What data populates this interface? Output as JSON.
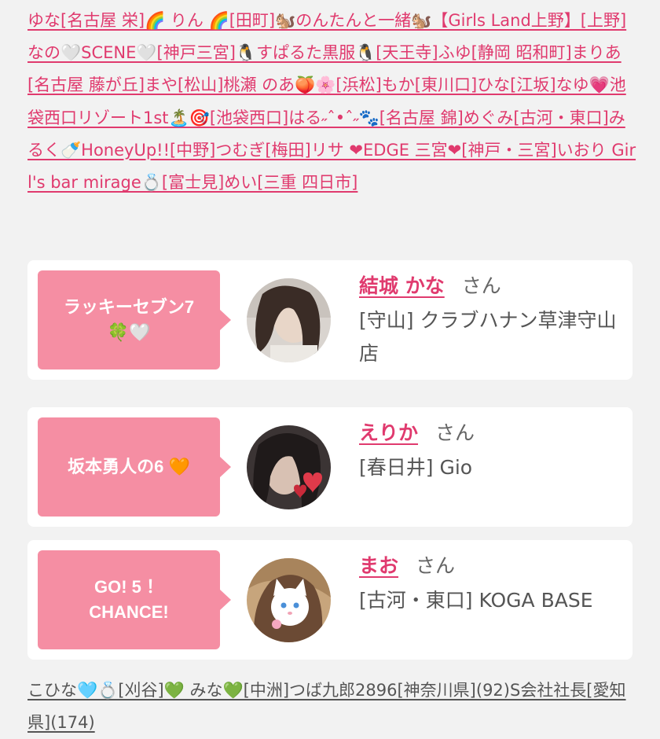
{
  "top_links_text": "ゆな[名古屋 栄]🌈 りん 🌈[田町]🐿️のんたんと一緒🐿️【Girls Land上野】[上野]なの🤍SCENE🤍[神戸三宮]🐧すぱるた黒服🐧[天王寺]ふゆ[静岡 昭和町]まりあ[名古屋 藤が丘]まや[松山]桃瀬 のあ🍑🌸[浜松]もか[東川口]ひな[江坂]なゆ💗池袋西口リゾート1st🏝️🎯[池袋西口]はる˶ˆ•ˆ˶🐾[名古屋 錦]めぐみ[古河・東口]みるく🍼HoneyUp!![中野]つむぎ[梅田]リサ ❤EDGE 三宮❤[神戸・三宮]いおり Girl's bar mirage💍[富士見]めい[三重 四日市]",
  "cards": [
    {
      "badge_line1": "ラッキーセブン7",
      "badge_line2": "🍀🤍",
      "name": "結城 かな",
      "honorific": "さん",
      "shop": "[守山] クラブハナン草津守山店"
    },
    {
      "badge_line1": "坂本勇人の6 🧡",
      "badge_line2": "",
      "name": "えりか",
      "honorific": "さん",
      "shop": "[春日井] Gio"
    },
    {
      "badge_line1": "GO! 5 ！",
      "badge_line2": "CHANCE!",
      "name": "まお",
      "honorific": "さん",
      "shop": "[古河・東口] KOGA BASE"
    }
  ],
  "bottom_links": {
    "pink_part": "こひな🩵💍[刈谷]💚 みな💚[中洲]",
    "blue_part": "つば九郎2896[神奈川県](92)S会社社長[愛知県](174)"
  },
  "colors": {
    "accent_pink": "#e03a6e",
    "badge_pink": "#f58ea3",
    "link_blue": "#2f6fb5",
    "background": "#f2f2f2"
  }
}
